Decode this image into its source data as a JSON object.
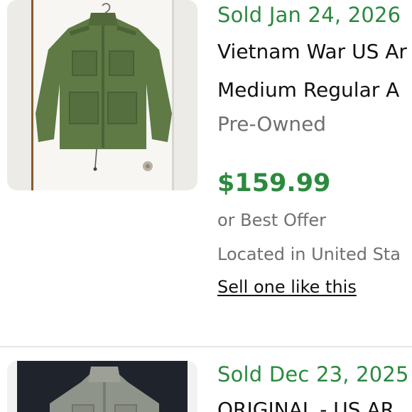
{
  "listings": [
    {
      "sold_date": "Sold Jan 24, 2026",
      "title_line1": "Vietnam War US Ar",
      "title_line2": "Medium Regular A",
      "condition": "Pre-Owned",
      "price": "$159.99",
      "offer": "or Best Offer",
      "location": "Located in United Sta",
      "sell_link": "Sell one like this",
      "image_desc_icon": "jacket-photo"
    },
    {
      "sold_date": "Sold Dec 23, 2025",
      "title_line1": "ORIGINAL - US AR",
      "image_desc_icon": "jacket-photo"
    }
  ],
  "colors": {
    "sold_green": "#2b8a3e",
    "title_black": "#111111",
    "meta_gray": "#707070",
    "jacket_olive": "#5f7a45",
    "jacket2_gray": "#8f948a",
    "divider": "#e6e6e6"
  }
}
